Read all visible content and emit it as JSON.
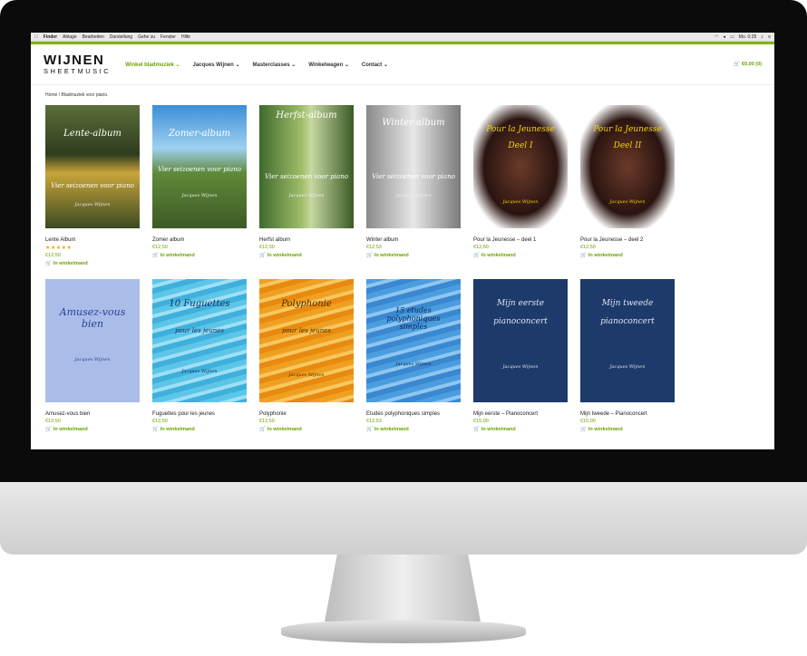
{
  "menubar": {
    "apple_icon": "apple-icon",
    "items": [
      "Finder",
      "Ablage",
      "Bearbeiten",
      "Darstellung",
      "Gehe zu",
      "Fenster",
      "Hilfe"
    ],
    "clock": "Mo. 0:25"
  },
  "header": {
    "logo_top": "WIJNEN",
    "logo_bottom": "SHEETMUSIC",
    "nav": [
      "Winkel bladmuziek",
      "Jacques Wijnen",
      "Masterclasses",
      "Winkelwagen",
      "Contact"
    ],
    "cart_total": "€0,00 (0)"
  },
  "breadcrumb": "Home / Bladmuziek voor piano.",
  "add_to_cart_label": "In winkelmand",
  "products": [
    {
      "name": "Lente Album",
      "price": "€12,50",
      "rating": 5,
      "stars": "★★★★★",
      "cover_title": "Lente-album",
      "cover_sub": "Vier seizoenen voor piano",
      "cover_author": "Jacques Wijnen"
    },
    {
      "name": "Zomer album",
      "price": "€12,50",
      "cover_title": "Zomer-album",
      "cover_sub": "Vier seizoenen voor piano",
      "cover_author": "Jacques Wijnen"
    },
    {
      "name": "Herfst album",
      "price": "€12,50",
      "cover_title": "Herfst-album",
      "cover_sub": "Vier seizoenen voor piano",
      "cover_author": "Jacques Wijnen"
    },
    {
      "name": "Winter album",
      "price": "€12,53",
      "cover_title": "Winter-album",
      "cover_sub": "Vier seizoenen voor piano",
      "cover_author": "Jacques Wijnen"
    },
    {
      "name": "Pour la Jeunesse – deel 1",
      "price": "€12,50",
      "cover_title": "Pour la Jeunesse",
      "cover_sub": "Deel I",
      "cover_author": "Jacques Wijnen"
    },
    {
      "name": "Pour la Jeunesse – deel 2",
      "price": "€12,50",
      "cover_title": "Pour la Jeunesse",
      "cover_sub": "Deel II",
      "cover_author": "Jacques Wijnen"
    },
    {
      "name": "Amusez-vous bien",
      "price": "€12,50",
      "cover_title": "Amusez-vous bien",
      "cover_sub": "",
      "cover_author": "Jacques Wijnen"
    },
    {
      "name": "Fuguettes pour les jeunes",
      "price": "€12,50",
      "cover_title": "10 Fuguettes",
      "cover_sub": "pour les jeunes",
      "cover_author": "Jacques Wijnen"
    },
    {
      "name": "Polyphonie",
      "price": "€12,50",
      "cover_title": "Polyphonie",
      "cover_sub": "pour les jeunes",
      "cover_author": "Jacques Wijnen"
    },
    {
      "name": "Etudes polyphoniques simples",
      "price": "€12,53",
      "cover_title": "15 etudes polyphoniques simples",
      "cover_sub": "",
      "cover_author": "Jacques Wijnen"
    },
    {
      "name": "Mijn eerste – Pianoconcert",
      "price": "€15,00",
      "cover_title": "Mijn eerste",
      "cover_sub": "pianoconcert",
      "cover_author": "Jacques Wijnen"
    },
    {
      "name": "Mijn tweede – Pianoconcert",
      "price": "€15,00",
      "cover_title": "Mijn tweede",
      "cover_sub": "pianoconcert",
      "cover_author": "Jacques Wijnen"
    }
  ],
  "colors": {
    "accent": "#7ab800",
    "link_green": "#6aa300",
    "star": "#e0b000"
  }
}
